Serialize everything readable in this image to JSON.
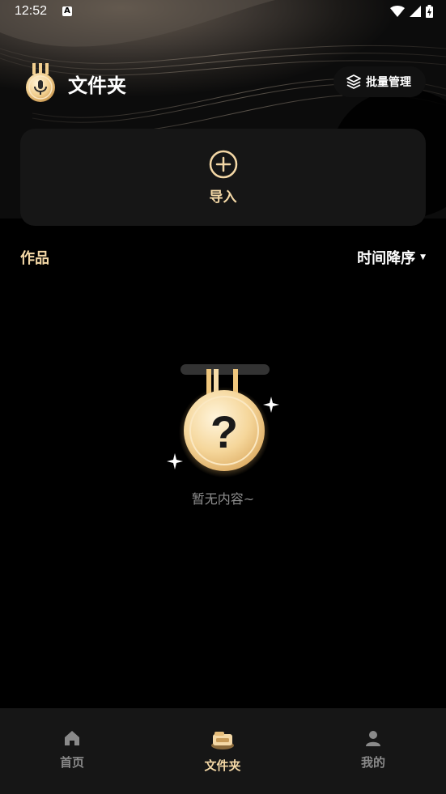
{
  "status_bar": {
    "time": "12:52",
    "notification_badge": "A"
  },
  "header": {
    "title": "文件夹",
    "batch_button": "批量管理"
  },
  "import": {
    "label": "导入"
  },
  "section": {
    "works_label": "作品",
    "sort_label": "时间降序"
  },
  "empty_state": {
    "text": "暂无内容~"
  },
  "bottom_nav": {
    "items": [
      {
        "label": "首页",
        "icon": "home-icon"
      },
      {
        "label": "文件夹",
        "icon": "folder-icon"
      },
      {
        "label": "我的",
        "icon": "profile-icon"
      }
    ],
    "active_index": 1
  },
  "colors": {
    "accent_gold": "#f4d8a6",
    "background": "#000000",
    "card": "#161616"
  }
}
